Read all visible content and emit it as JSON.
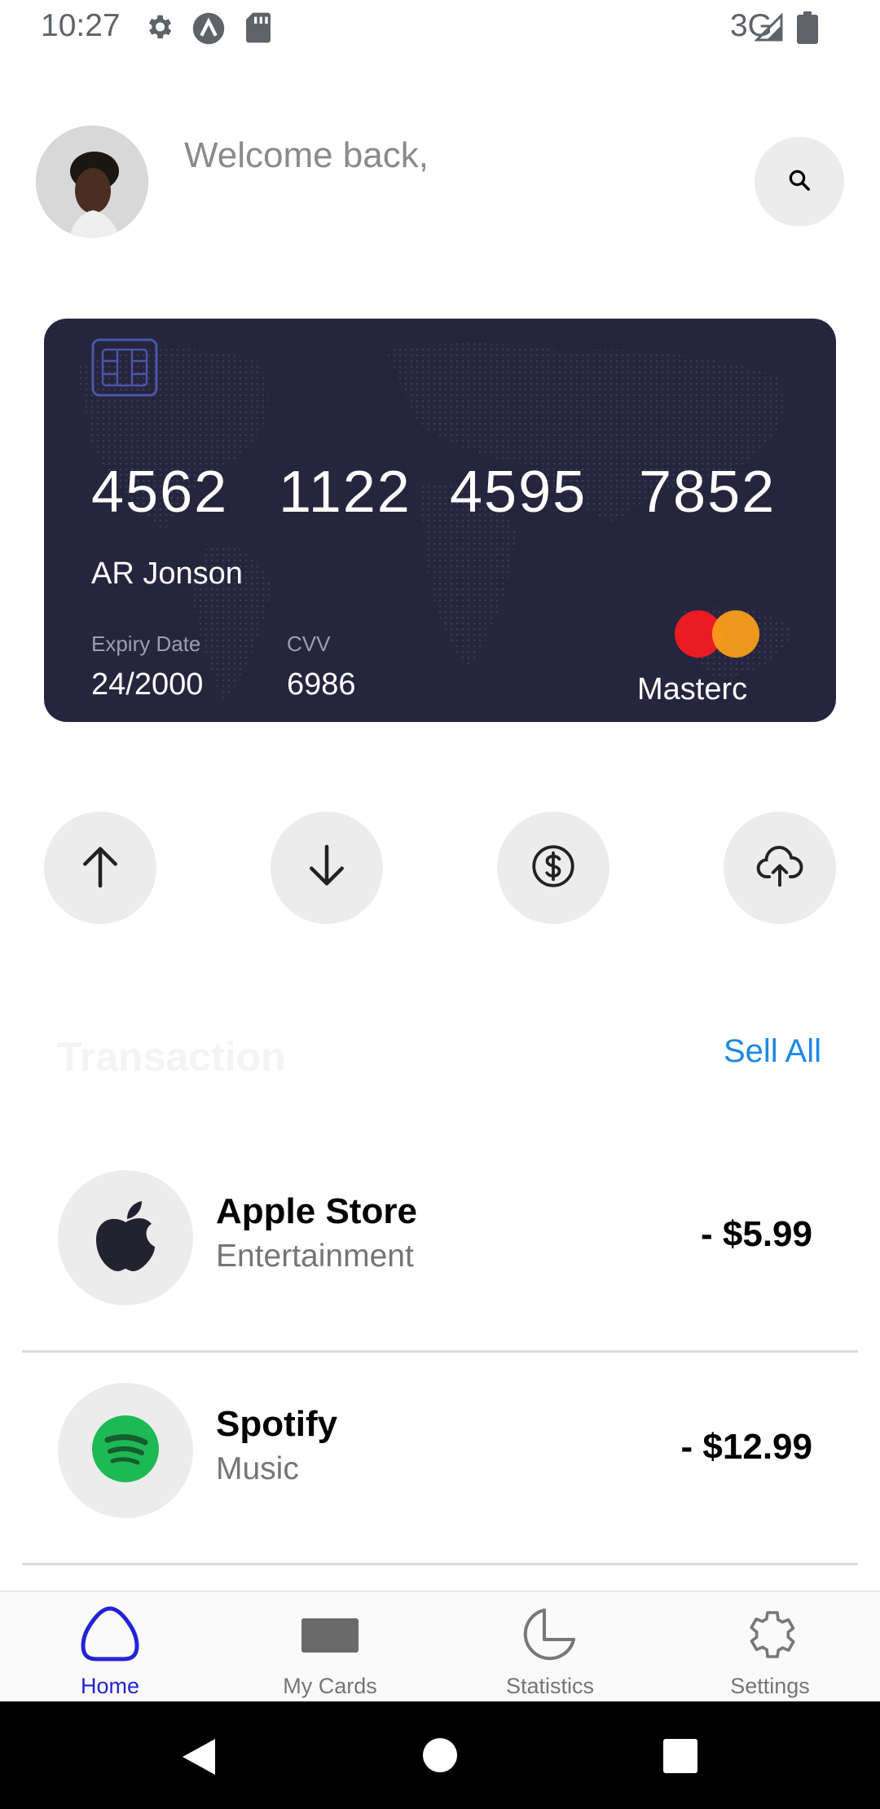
{
  "status_bar": {
    "time": "10:27",
    "network": "3G",
    "icons": [
      "gear-icon",
      "app-a-icon",
      "sd-card-icon",
      "signal-icon",
      "battery-icon"
    ]
  },
  "header": {
    "welcome": "Welcome back,",
    "search_icon": "search-icon"
  },
  "card": {
    "number_groups": [
      "4562",
      "1122",
      "4595",
      "7852"
    ],
    "holder": "AR Jonson",
    "expiry_label": "Expiry Date",
    "expiry": "24/2000",
    "cvv_label": "CVV",
    "cvv": "6986",
    "brand": "Masterc",
    "background_color": "#26253d"
  },
  "actions": [
    {
      "icon": "arrow-up-icon"
    },
    {
      "icon": "arrow-down-icon"
    },
    {
      "icon": "dollar-icon"
    },
    {
      "icon": "cloud-upload-icon"
    }
  ],
  "transactions": {
    "title": "Transaction",
    "see_all": "Sell All",
    "items": [
      {
        "name": "Apple Store",
        "category": "Entertainment",
        "amount": "- $5.99",
        "icon": "apple-icon"
      },
      {
        "name": "Spotify",
        "category": "Music",
        "amount": "- $12.99",
        "icon": "spotify-icon"
      }
    ]
  },
  "bottom_nav": {
    "active_color": "#2323d6",
    "items": [
      {
        "label": "Home",
        "icon": "home-icon",
        "active": true
      },
      {
        "label": "My Cards",
        "icon": "card-icon",
        "active": false
      },
      {
        "label": "Statistics",
        "icon": "pie-chart-icon",
        "active": false
      },
      {
        "label": "Settings",
        "icon": "settings-icon",
        "active": false
      }
    ]
  },
  "system_nav": {
    "icons": [
      "back-icon",
      "home-circle-icon",
      "recents-icon"
    ]
  }
}
